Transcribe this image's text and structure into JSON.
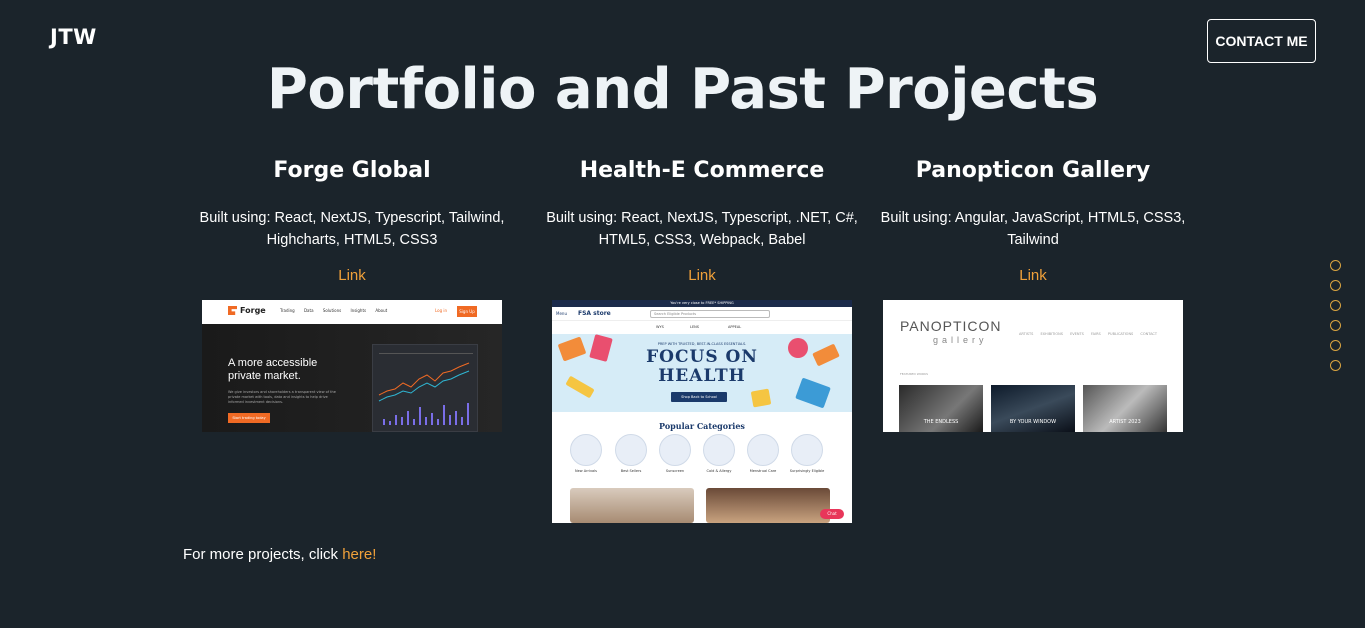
{
  "header": {
    "logo": "JTW",
    "contact_label": "CONTACT ME"
  },
  "page_title": "Portfolio and Past Projects",
  "projects": [
    {
      "name": "Forge Global",
      "description": "Built using: React, NextJS, Typescript, Tailwind, Highcharts, HTML5, CSS3",
      "link_label": "Link",
      "screenshot": {
        "brand": "Forge",
        "menu": [
          "Trading",
          "Data",
          "Solutions",
          "Insights",
          "About"
        ],
        "login": "Log in",
        "signup": "Sign Up",
        "headline_1": "A more accessible",
        "headline_2": "private market.",
        "sub": "We give investors and shareholders a transparent view of the private market with tools, data and insights to help drive informed investment decisions.",
        "cta": "Start trading today"
      }
    },
    {
      "name": "Health-E Commerce",
      "description": "Built using: React, NextJS, Typescript, .NET, C#, HTML5, CSS3, Webpack, Babel",
      "link_label": "Link",
      "screenshot": {
        "topbar": "You're very close to FREE* SHIPPING",
        "menu": "Menu",
        "store": "FSA store",
        "search_placeholder": "Search Eligible Products",
        "subnav": [
          "WYS",
          "LENS",
          "APPEAL"
        ],
        "tagline": "PREP WITH TRUSTED, BEST-IN-CLASS ESSENTIALS.",
        "headline_1": "FOCUS ON",
        "headline_2": "HEALTH",
        "shop_label": "Shop Back to School",
        "categories_title": "Popular Categories",
        "categories": [
          "New Arrivals",
          "Best Sellers",
          "Sunscreen",
          "Cold & Allergy",
          "Menstrual Care",
          "Surprisingly Eligible"
        ],
        "chat": "Chat"
      }
    },
    {
      "name": "Panopticon Gallery",
      "description": "Built using: Angular, JavaScript, HTML5, CSS3, Tailwind",
      "link_label": "Link",
      "screenshot": {
        "brand_1": "PANOPTICON",
        "brand_2": "gallery",
        "menu": [
          "ARTISTS",
          "EXHIBITIONS",
          "EVENTS",
          "FAIRS",
          "PUBLICATIONS",
          "CONTACT"
        ],
        "section": "FEATURED WORKS",
        "tiles": [
          "THE ENDLESS",
          "BY YOUR WINDOW",
          "ARTIST 2023"
        ]
      }
    }
  ],
  "footer": {
    "more_text": "For more projects, click ",
    "more_link": "here!"
  },
  "side_nav_count": 6,
  "colors": {
    "background": "#1b242b",
    "accent": "#f0a13a",
    "dot": "#d9a441"
  }
}
